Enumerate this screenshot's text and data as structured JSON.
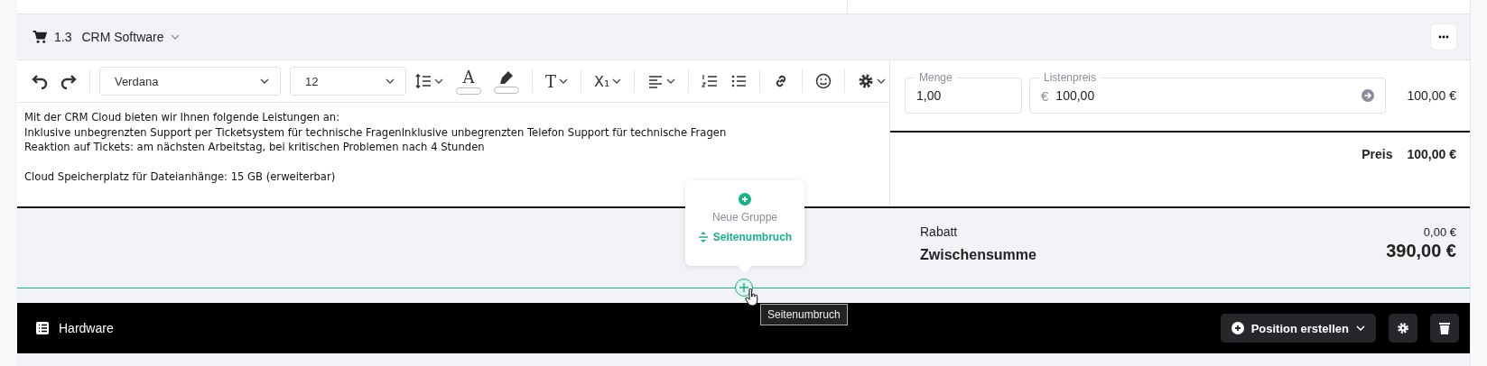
{
  "group_header": {
    "number": "1.3",
    "title": "CRM Software"
  },
  "toolbar": {
    "font": "Verdana",
    "size": "12",
    "text_color_glyph": "A",
    "text_style_glyph": "T",
    "subscript_glyph": "X₁"
  },
  "description": {
    "paragraphs": [
      [
        "Mit der CRM Cloud bieten wir Ihnen folgende Leistungen an:",
        "Inklusive unbegrenzten Support per Ticketsystem für technische FragenInklusive unbegrenzten Telefon Support für technische Fragen",
        "Reaktion auf Tickets: am nächsten Arbeitstag, bei kritischen Problemen nach 4 Stunden"
      ],
      [
        "Cloud Speicherplatz für Dateianhänge: 15 GB (erweiterbar)"
      ]
    ]
  },
  "quantity": {
    "label": "Menge",
    "value": "1,00"
  },
  "list_price": {
    "label": "Listenpreis",
    "currency": "€",
    "value": "100,00"
  },
  "line_total": "100,00 €",
  "price": {
    "label": "Preis",
    "value": "100,00 €"
  },
  "discount": {
    "label": "Rabatt",
    "value": "0,00 €"
  },
  "subtotal": {
    "label": "Zwischensumme",
    "value": "390,00 €"
  },
  "insert_menu": {
    "items": [
      {
        "kind": "group",
        "label": "Neue Gruppe"
      },
      {
        "kind": "page_break",
        "label": "Seitenumbruch"
      }
    ]
  },
  "tooltip": "Seitenumbruch",
  "section": {
    "title": "Hardware",
    "create_button": "Position erstellen"
  }
}
